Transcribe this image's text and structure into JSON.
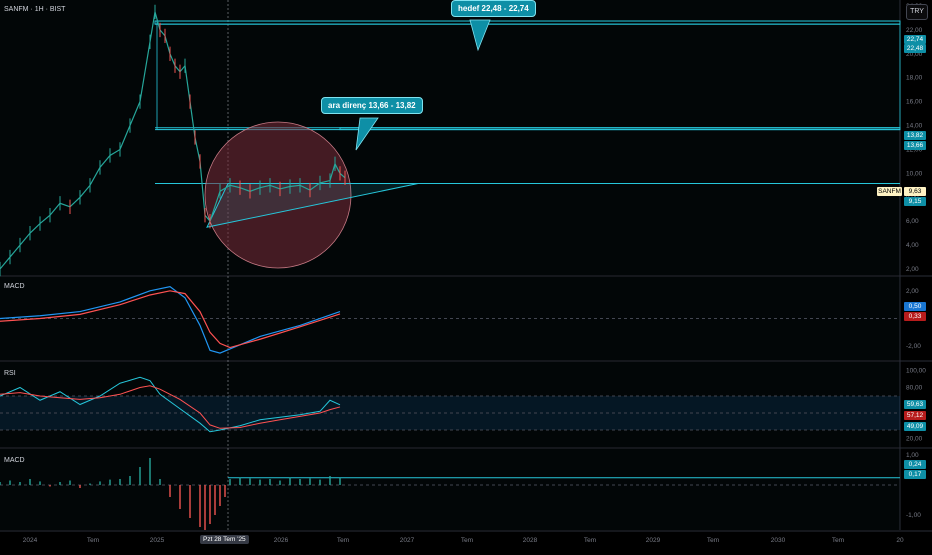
{
  "header": {
    "symbol_line": "SANFM · 1H · BIST",
    "currency_button": "TRY"
  },
  "panes": {
    "macd_title": "MACD",
    "rsi_title": "RSI",
    "hist_title": "MACD"
  },
  "callouts": {
    "target": "hedef 22,48 - 22,74",
    "resistance": "ara direnç 13,66 - 13,82"
  },
  "price_labels": {
    "top_1": "22,74",
    "top_2": "22,48",
    "mid_1": "13,82",
    "mid_2": "13,66",
    "symbol_tag": "SANFM",
    "last": "9,63",
    "support": "9,15",
    "macd_1": "0,50",
    "macd_2": "0,33",
    "rsi_1": "59,63",
    "rsi_2": "57,12",
    "rsi_3": "49,09",
    "hist_1": "0,24",
    "hist_2": "0,17"
  },
  "crosshair_label": "Pzt 28 Tem '25",
  "colors": {
    "accent": "#26c6da",
    "candle_up": "#26a69a",
    "candle_down": "#ef5350",
    "circle_fill": "#7b2d3a",
    "macd_line": "#2196f3",
    "signal_line": "#ff5252",
    "rsi_line": "#7e57c2"
  },
  "chart_data": [
    {
      "type": "line",
      "name": "price",
      "x_ticks": [
        "2024",
        "Tem",
        "2025",
        "Tem",
        "2026",
        "Tem",
        "2027",
        "Tem",
        "2028",
        "Tem",
        "2029",
        "Tem",
        "2030",
        "Tem",
        "20"
      ],
      "y_ticks": [
        "24,00",
        "22,00",
        "20,00",
        "18,00",
        "16,00",
        "14,00",
        "12,00",
        "10,00",
        "8,00",
        "6,00",
        "4,00",
        "2,00"
      ],
      "ylim": [
        1.5,
        24.5
      ],
      "x": [
        0,
        10,
        20,
        30,
        40,
        50,
        60,
        70,
        80,
        90,
        100,
        110,
        120,
        130,
        140,
        150,
        155,
        160,
        165,
        170,
        175,
        180,
        185,
        190,
        195,
        200,
        205,
        210,
        220,
        230,
        240,
        250,
        260,
        270,
        280,
        290,
        300,
        310,
        320,
        330,
        335,
        340,
        345
      ],
      "values": [
        2.0,
        3.0,
        4.0,
        5.0,
        5.8,
        6.5,
        7.5,
        7.2,
        8.0,
        9.0,
        10.5,
        11.5,
        12.0,
        14.0,
        16.0,
        21.0,
        23.5,
        22.0,
        21.5,
        20.0,
        19.0,
        18.5,
        19.0,
        16.0,
        13.0,
        11.0,
        6.5,
        6.0,
        8.5,
        9.0,
        8.8,
        8.5,
        8.8,
        9.0,
        8.7,
        8.9,
        9.0,
        8.6,
        9.2,
        9.4,
        10.8,
        10.0,
        9.63
      ]
    },
    {
      "type": "line",
      "name": "MACD",
      "y_ticks": [
        "2,00",
        "-2,00"
      ],
      "ylim": [
        -3.0,
        3.0
      ],
      "x": [
        0,
        40,
        80,
        120,
        150,
        170,
        185,
        200,
        210,
        220,
        230,
        260,
        300,
        340
      ],
      "series": [
        {
          "values": [
            0.0,
            0.2,
            0.5,
            1.2,
            2.0,
            2.3,
            1.5,
            -0.5,
            -2.3,
            -2.5,
            -2.2,
            -1.3,
            -0.5,
            0.5
          ]
        },
        {
          "values": [
            -0.2,
            0.0,
            0.3,
            1.0,
            1.7,
            2.0,
            1.8,
            0.5,
            -1.0,
            -1.8,
            -2.1,
            -1.5,
            -0.6,
            0.33
          ]
        }
      ]
    },
    {
      "type": "line",
      "name": "RSI",
      "y_ticks": [
        "100,00",
        "80,00",
        "20,00"
      ],
      "ylim": [
        10,
        110
      ],
      "x": [
        0,
        20,
        40,
        60,
        80,
        100,
        120,
        140,
        150,
        160,
        180,
        200,
        210,
        220,
        240,
        260,
        280,
        300,
        320,
        330,
        340
      ],
      "series": [
        {
          "values": [
            70,
            80,
            65,
            75,
            60,
            70,
            85,
            92,
            88,
            72,
            55,
            38,
            28,
            30,
            35,
            42,
            45,
            48,
            52,
            65,
            59.63
          ]
        },
        {
          "values": [
            72,
            74,
            70,
            68,
            66,
            68,
            72,
            80,
            82,
            78,
            66,
            50,
            36,
            32,
            33,
            38,
            42,
            46,
            50,
            54,
            57.12
          ]
        }
      ]
    },
    {
      "type": "bar",
      "name": "MACD histogram",
      "y_ticks": [
        "1,00",
        "-1,00"
      ],
      "ylim": [
        -1.5,
        1.2
      ],
      "x": [
        0,
        10,
        20,
        30,
        40,
        50,
        60,
        70,
        80,
        90,
        100,
        110,
        120,
        130,
        140,
        150,
        160,
        170,
        180,
        190,
        200,
        205,
        210,
        215,
        220,
        225,
        230,
        240,
        250,
        260,
        270,
        280,
        290,
        300,
        310,
        320,
        330,
        340
      ],
      "values": [
        0.1,
        0.15,
        0.1,
        0.2,
        0.12,
        -0.05,
        0.1,
        0.15,
        -0.1,
        0.05,
        0.12,
        0.18,
        0.2,
        0.3,
        0.6,
        0.9,
        0.2,
        -0.4,
        -0.8,
        -1.1,
        -1.4,
        -1.5,
        -1.3,
        -1.0,
        -0.7,
        -0.4,
        0.2,
        0.25,
        0.22,
        0.18,
        0.2,
        0.15,
        0.25,
        0.2,
        0.22,
        0.18,
        0.3,
        0.24
      ]
    }
  ]
}
